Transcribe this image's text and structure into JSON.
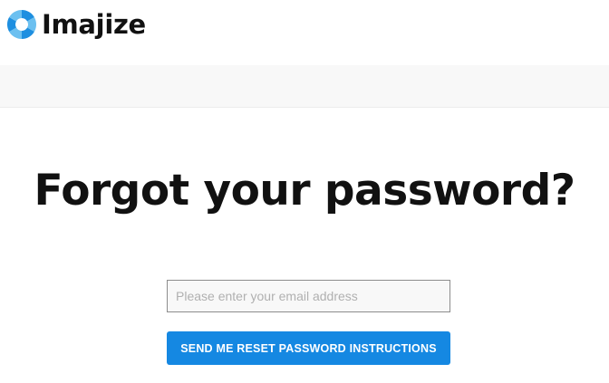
{
  "brand": {
    "name": "Imajize",
    "logo_icon": "aperture-icon",
    "logo_colors": [
      "#1e8fe0",
      "#6cc0f0"
    ]
  },
  "page": {
    "title": "Forgot your password?"
  },
  "form": {
    "email_placeholder": "Please enter your email address",
    "email_value": "",
    "submit_label": "SEND ME RESET PASSWORD INSTRUCTIONS",
    "submit_color": "#1588e2"
  }
}
